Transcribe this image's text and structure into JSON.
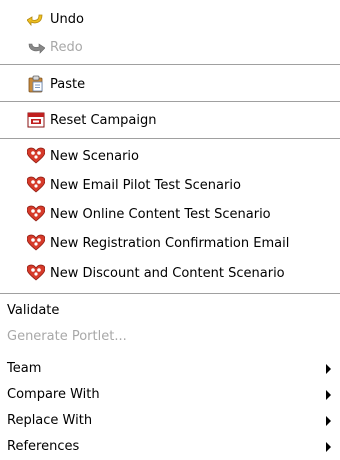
{
  "menu": {
    "undo": {
      "label": "Undo",
      "icon": "undo-arrow-icon"
    },
    "redo": {
      "label": "Redo",
      "icon": "redo-arrow-icon"
    },
    "paste": {
      "label": "Paste",
      "icon": "clipboard-icon"
    },
    "reset_campaign": {
      "label": "Reset Campaign",
      "icon": "reset-campaign-icon"
    },
    "scenarios": [
      {
        "label": "New Scenario",
        "icon": "scenario-icon"
      },
      {
        "label": "New Email Pilot Test Scenario",
        "icon": "scenario-icon"
      },
      {
        "label": "New Online Content Test Scenario",
        "icon": "scenario-icon"
      },
      {
        "label": "New Registration Confirmation Email",
        "icon": "scenario-icon"
      },
      {
        "label": "New Discount and Content Scenario",
        "icon": "scenario-icon"
      }
    ],
    "validate": {
      "label": "Validate"
    },
    "generate_portlet": {
      "label": "Generate Portlet..."
    },
    "submenus": [
      {
        "label": "Team"
      },
      {
        "label": "Compare With"
      },
      {
        "label": "Replace With"
      },
      {
        "label": "References"
      }
    ]
  },
  "colors": {
    "separator": "#a0a0a0",
    "disabled_text": "#a8a8a8",
    "undo_arrow": "#f0c020",
    "redo_arrow": "#888888",
    "scenario_icon": "#d63a2a"
  }
}
